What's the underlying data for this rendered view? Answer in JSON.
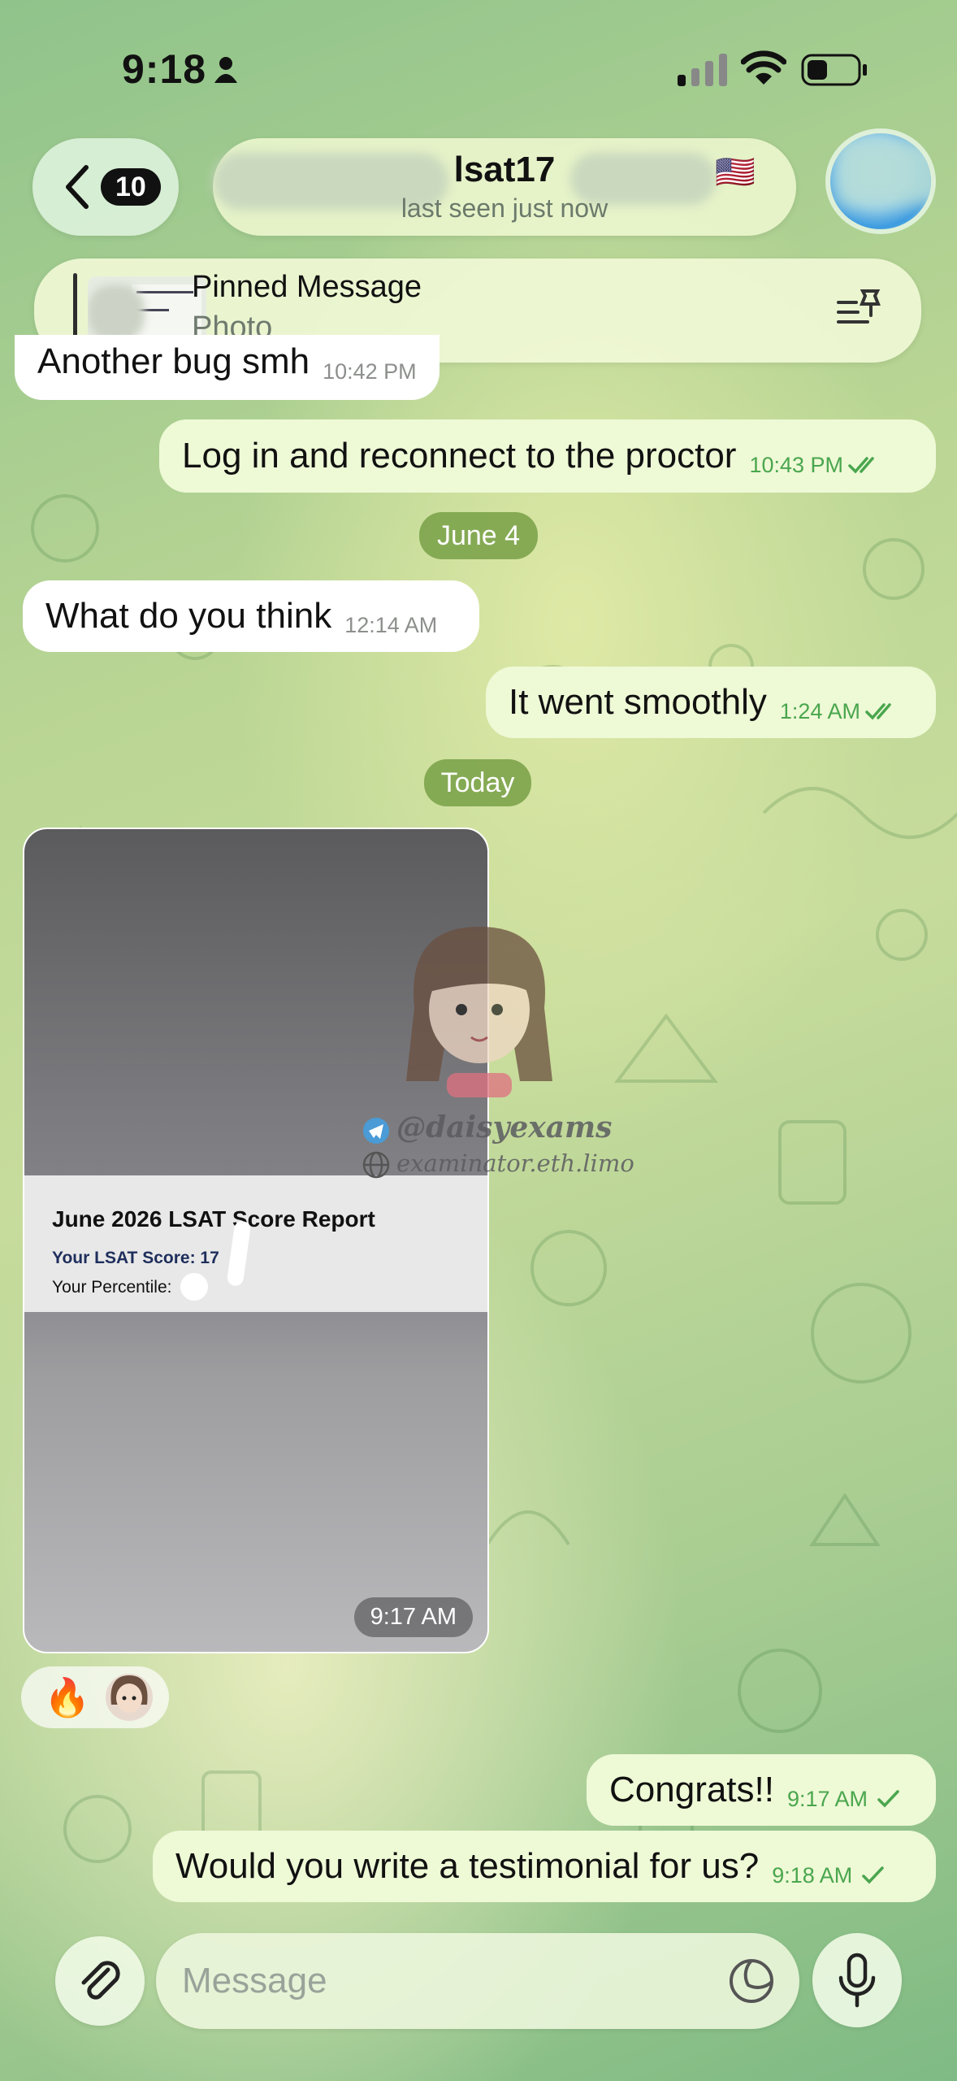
{
  "status_bar": {
    "time": "9:18"
  },
  "header": {
    "back_count": "10",
    "contact_name": "lsat17",
    "flag": "🇺🇸",
    "last_seen": "last seen just now"
  },
  "pinned": {
    "title": "Pinned Message",
    "subtitle": "Photo"
  },
  "messages": [
    {
      "text": "Another bug smh",
      "time": "10:42 PM"
    },
    {
      "text": "Log in and reconnect to the proctor",
      "time": "10:43 PM"
    },
    {
      "text": "What do you think",
      "time": "12:14 AM"
    },
    {
      "text": "It went smoothly",
      "time": "1:24 AM"
    },
    {
      "text": "Congrats!!",
      "time": "9:17 AM"
    },
    {
      "text": "Would you write a testimonial for us?",
      "time": "9:18 AM"
    }
  ],
  "date_separators": [
    "June 4",
    "Today"
  ],
  "photo": {
    "title": "June 2026 LSAT Score Report",
    "score_label": "Your LSAT Score: 17",
    "percentile_label": "Your Percentile:",
    "time": "9:17 AM",
    "watermark_handle": "@daisyexams",
    "watermark_site": "examinator.eth.limo"
  },
  "reactions": {
    "emoji": "🔥"
  },
  "input": {
    "placeholder": "Message"
  },
  "icons": {
    "status": [
      "person-icon",
      "signal-icon",
      "wifi-icon",
      "battery-icon"
    ],
    "header": [
      "chevron-left-icon",
      "avatar"
    ],
    "pinned": [
      "pin-list-icon"
    ],
    "input": [
      "paperclip-icon",
      "sticker-icon",
      "microphone-icon"
    ]
  },
  "colors": {
    "outgoing_bubble": "#eef9d6",
    "incoming_bubble": "#ffffff",
    "read_tick": "#4aa64e",
    "date_pill": "#78a046"
  }
}
